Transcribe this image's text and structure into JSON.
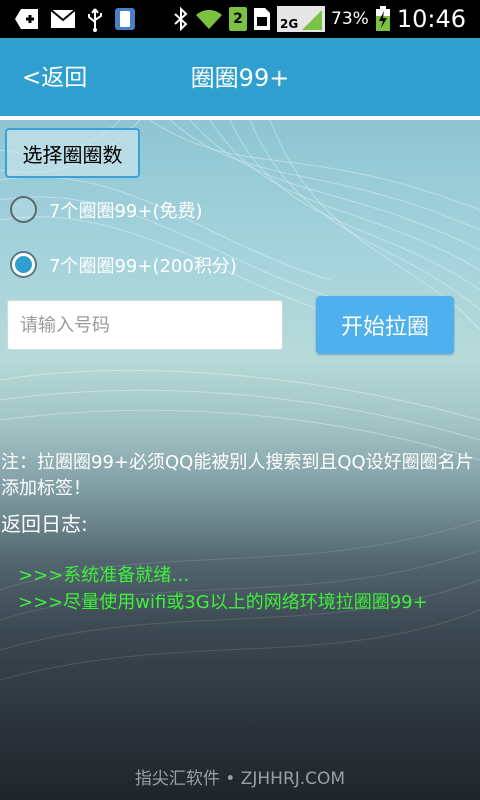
{
  "status_bar": {
    "battery_percent": "73%",
    "time": "10:46",
    "sim_slot": "2",
    "network": "2G",
    "icons": [
      "add-icon",
      "mail-icon",
      "usb-icon",
      "phone-manager-icon",
      "bluetooth-icon",
      "wifi-icon",
      "sim-card-icon",
      "signal-icon",
      "battery-charging-icon"
    ]
  },
  "title_bar": {
    "back_label": "<返回",
    "title": "圈圈99+"
  },
  "form": {
    "section_title": "选择圈圈数",
    "options": [
      {
        "label": "7个圈圈99+(免费)",
        "checked": false
      },
      {
        "label": "7个圈圈99+(200积分)",
        "checked": true
      }
    ],
    "input_placeholder": "请输入号码",
    "input_value": "",
    "start_button": "开始拉圈"
  },
  "note": "注：拉圈圈99+必须QQ能被别人搜索到且QQ设好圈圈名片添加标签！",
  "log": {
    "title": "返回日志:",
    "lines": [
      ">>>系统准备就绪…",
      ">>>尽量使用wifi或3G以上的网络环境拉圈圈99+"
    ]
  },
  "watermark": "指尖汇软件 • ZJHHRJ.COM",
  "colors": {
    "title_bar": "#2e9fcf",
    "button": "#4fb0ee",
    "log_text": "#3ef03a"
  }
}
